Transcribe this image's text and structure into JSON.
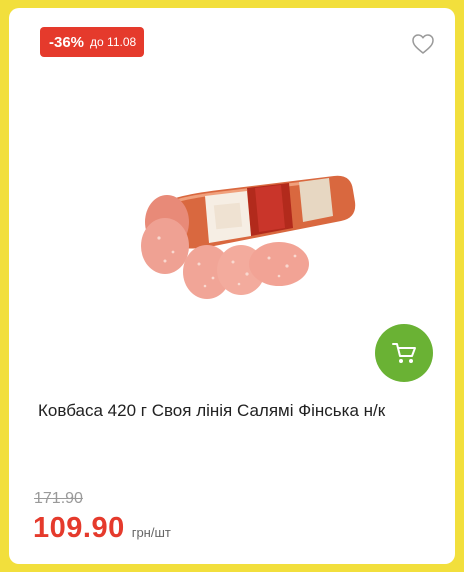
{
  "badge": {
    "discount": "-36%",
    "until": "до 11.08"
  },
  "product": {
    "name": "Ковбаса 420 г Своя лінія Салямі Фінська н/к"
  },
  "price": {
    "old": "171.90",
    "current": "109.90",
    "unit": "грн/шт"
  },
  "icons": {
    "favorite": "heart-outline-icon",
    "cart": "cart-icon"
  },
  "colors": {
    "accent": "#e53a2c",
    "cart_button": "#6ab234",
    "background": "#f2df3c"
  }
}
